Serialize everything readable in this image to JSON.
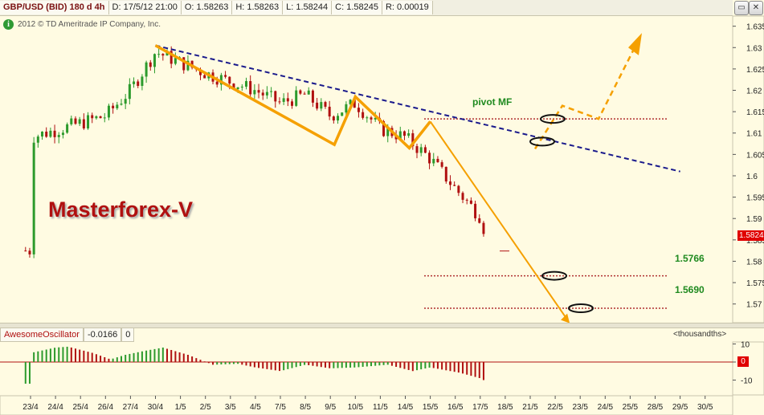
{
  "header": {
    "symbol": "GBP/USD (BID) 180 d 4h",
    "date": "D: 17/5/12 21:00",
    "open": "O: 1.58263",
    "high": "H: 1.58263",
    "low": "L: 1.58244",
    "close": "C: 1.58245",
    "range": "R: 0.00019"
  },
  "copyright": "2012 © TD Ameritrade IP Company, Inc.",
  "watermark": "Masterforex-V",
  "current_price_tag": "1.5824",
  "levels": {
    "pivot_label": "pivot MF",
    "level1": "1.5766",
    "level2": "1.5690"
  },
  "oscillator": {
    "name": "AwesomeOscillator",
    "value": "-0.0166",
    "param": "0",
    "units": "<thousandths>",
    "current_tag": "0"
  },
  "colors": {
    "background": "#fffbe2",
    "candle_up": "#2c9a2c",
    "candle_down": "#b01010",
    "orange": "#f5a000",
    "trendline": "#1a1a8c",
    "level": "#b03030",
    "price_tag": "#e00000"
  },
  "chart_data": [
    {
      "type": "candlestick",
      "title": "GBP/USD (BID) 180 d 4h",
      "ylim": [
        1.566,
        1.637
      ],
      "y_ticks": [
        "1.635",
        "1.63",
        "1.625",
        "1.62",
        "1.615",
        "1.61",
        "1.605",
        "1.6",
        "1.595",
        "1.59",
        "1.585",
        "1.58",
        "1.575",
        "1.57"
      ],
      "x_ticks": [
        "23/4",
        "24/4",
        "25/4",
        "26/4",
        "27/4",
        "30/4",
        "1/5",
        "2/5",
        "3/5",
        "4/5",
        "7/5",
        "8/5",
        "9/5",
        "10/5",
        "11/5",
        "14/5",
        "15/5",
        "16/5",
        "17/5",
        "18/5",
        "21/5",
        "22/5",
        "23/5",
        "24/5",
        "25/5",
        "28/5",
        "29/5",
        "30/5"
      ],
      "pattern_points": [
        {
          "x": "30/4",
          "y": 1.6305
        },
        {
          "x": "9/5",
          "y": 1.6073
        },
        {
          "x": "10/5",
          "y": 1.6185
        },
        {
          "x": "14/5",
          "y": 1.6065
        },
        {
          "x": "15/5",
          "y": 1.6127
        },
        {
          "x": "22/5",
          "y": 1.5655
        }
      ],
      "trendline": [
        {
          "x": "30/4",
          "y": 1.6305
        },
        {
          "x": "30/5",
          "y": 1.601
        }
      ],
      "levels": [
        1.6133,
        1.5766,
        1.569
      ],
      "last_close": 1.5824
    },
    {
      "type": "bar",
      "title": "AwesomeOscillator",
      "ylim": [
        -15,
        15
      ],
      "y_ticks": [
        "10",
        "0",
        "-10"
      ],
      "last_value": -0.0166
    }
  ]
}
